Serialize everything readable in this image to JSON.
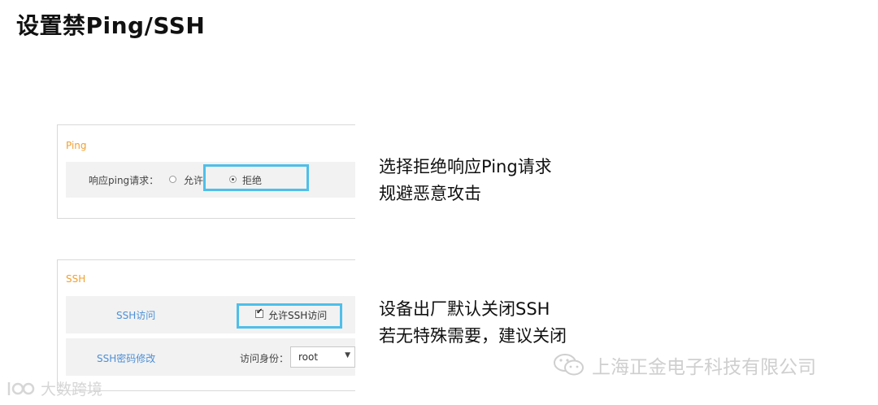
{
  "slide": {
    "title": "设置禁Ping/SSH"
  },
  "ping_panel": {
    "section_title": "Ping",
    "label": "响应ping请求：",
    "options": [
      "允许",
      "拒绝"
    ],
    "selected": "拒绝"
  },
  "ssh_panel": {
    "section_title": "SSH",
    "access_label": "SSH访问",
    "allow_checkbox_label": "允许SSH访问",
    "allow_checked": true,
    "password_label": "SSH密码修改",
    "identity_label": "访问身份：",
    "identity_value": "root"
  },
  "notes": {
    "ping": [
      "选择拒绝响应Ping请求",
      "规避恶意攻击"
    ],
    "ssh": [
      "设备出厂默认关闭SSH",
      "若无特殊需要，建议关闭"
    ]
  },
  "watermarks": {
    "company": "上海正金电子科技有限公司",
    "brand": "大数跨境"
  },
  "colors": {
    "section_title": "#f0a030",
    "highlight": "#4fbfe9",
    "link_label": "#4d8fd6"
  }
}
